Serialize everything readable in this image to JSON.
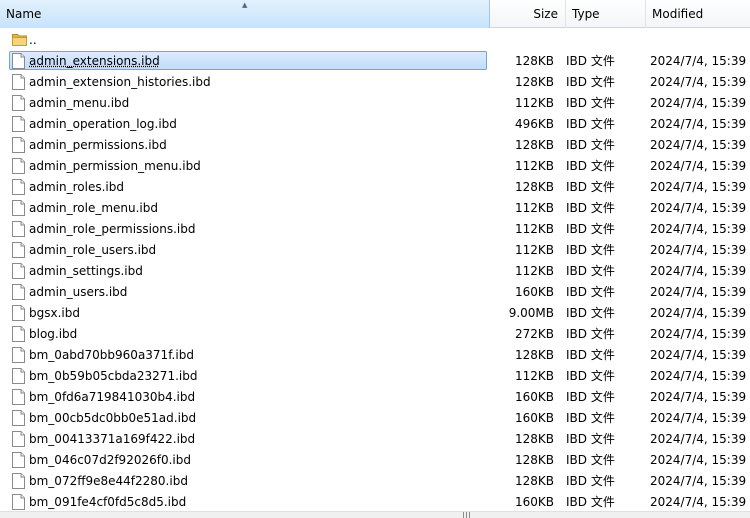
{
  "columns": {
    "name": "Name",
    "size": "Size",
    "type": "Type",
    "modified": "Modified"
  },
  "selected_index": 1,
  "rows": [
    {
      "name": "..",
      "size": "",
      "type": "",
      "modified": "",
      "icon": "folder-icon"
    },
    {
      "name": "admin_extensions.ibd",
      "size": "128KB",
      "type": "IBD 文件",
      "modified": "2024/7/4, 15:39",
      "icon": "file-icon"
    },
    {
      "name": "admin_extension_histories.ibd",
      "size": "128KB",
      "type": "IBD 文件",
      "modified": "2024/7/4, 15:39",
      "icon": "file-icon"
    },
    {
      "name": "admin_menu.ibd",
      "size": "112KB",
      "type": "IBD 文件",
      "modified": "2024/7/4, 15:39",
      "icon": "file-icon"
    },
    {
      "name": "admin_operation_log.ibd",
      "size": "496KB",
      "type": "IBD 文件",
      "modified": "2024/7/4, 15:39",
      "icon": "file-icon"
    },
    {
      "name": "admin_permissions.ibd",
      "size": "128KB",
      "type": "IBD 文件",
      "modified": "2024/7/4, 15:39",
      "icon": "file-icon"
    },
    {
      "name": "admin_permission_menu.ibd",
      "size": "112KB",
      "type": "IBD 文件",
      "modified": "2024/7/4, 15:39",
      "icon": "file-icon"
    },
    {
      "name": "admin_roles.ibd",
      "size": "128KB",
      "type": "IBD 文件",
      "modified": "2024/7/4, 15:39",
      "icon": "file-icon"
    },
    {
      "name": "admin_role_menu.ibd",
      "size": "112KB",
      "type": "IBD 文件",
      "modified": "2024/7/4, 15:39",
      "icon": "file-icon"
    },
    {
      "name": "admin_role_permissions.ibd",
      "size": "112KB",
      "type": "IBD 文件",
      "modified": "2024/7/4, 15:39",
      "icon": "file-icon"
    },
    {
      "name": "admin_role_users.ibd",
      "size": "112KB",
      "type": "IBD 文件",
      "modified": "2024/7/4, 15:39",
      "icon": "file-icon"
    },
    {
      "name": "admin_settings.ibd",
      "size": "112KB",
      "type": "IBD 文件",
      "modified": "2024/7/4, 15:39",
      "icon": "file-icon"
    },
    {
      "name": "admin_users.ibd",
      "size": "160KB",
      "type": "IBD 文件",
      "modified": "2024/7/4, 15:39",
      "icon": "file-icon"
    },
    {
      "name": "bgsx.ibd",
      "size": "9.00MB",
      "type": "IBD 文件",
      "modified": "2024/7/4, 15:39",
      "icon": "file-icon"
    },
    {
      "name": "blog.ibd",
      "size": "272KB",
      "type": "IBD 文件",
      "modified": "2024/7/4, 15:39",
      "icon": "file-icon"
    },
    {
      "name": "bm_0abd70bb960a371f.ibd",
      "size": "128KB",
      "type": "IBD 文件",
      "modified": "2024/7/4, 15:39",
      "icon": "file-icon"
    },
    {
      "name": "bm_0b59b05cbda23271.ibd",
      "size": "112KB",
      "type": "IBD 文件",
      "modified": "2024/7/4, 15:39",
      "icon": "file-icon"
    },
    {
      "name": "bm_0fd6a719841030b4.ibd",
      "size": "160KB",
      "type": "IBD 文件",
      "modified": "2024/7/4, 15:39",
      "icon": "file-icon"
    },
    {
      "name": "bm_00cb5dc0bb0e51ad.ibd",
      "size": "160KB",
      "type": "IBD 文件",
      "modified": "2024/7/4, 15:39",
      "icon": "file-icon"
    },
    {
      "name": "bm_00413371a169f422.ibd",
      "size": "128KB",
      "type": "IBD 文件",
      "modified": "2024/7/4, 15:39",
      "icon": "file-icon"
    },
    {
      "name": "bm_046c07d2f92026f0.ibd",
      "size": "128KB",
      "type": "IBD 文件",
      "modified": "2024/7/4, 15:39",
      "icon": "file-icon"
    },
    {
      "name": "bm_072ff9e8e44f2280.ibd",
      "size": "128KB",
      "type": "IBD 文件",
      "modified": "2024/7/4, 15:39",
      "icon": "file-icon"
    },
    {
      "name": "bm_091fe4cf0fd5c8d5.ibd",
      "size": "160KB",
      "type": "IBD 文件",
      "modified": "2024/7/4, 15:39",
      "icon": "file-icon"
    }
  ]
}
